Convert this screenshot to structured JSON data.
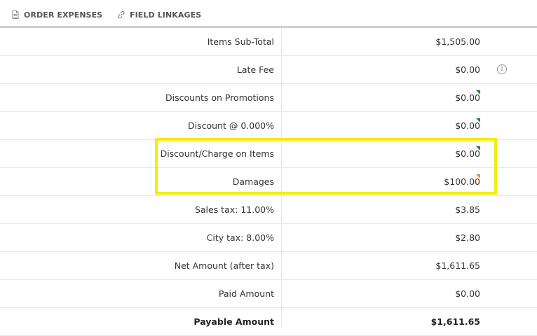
{
  "tabs": [
    {
      "label": "ORDER EXPENSES",
      "icon": "document-icon"
    },
    {
      "label": "FIELD LINKAGES",
      "icon": "link-icon"
    }
  ],
  "rows": [
    {
      "label": "Items Sub-Total",
      "value": "$1,505.00"
    },
    {
      "label": "Late Fee",
      "value": "$0.00",
      "icon": "info-icon"
    },
    {
      "label": "Discounts on Promotions",
      "value": "$0.00",
      "marker": "green"
    },
    {
      "label": "Discount @ 0.000%",
      "value": "$0.00",
      "marker": "green"
    },
    {
      "label": "Discount/Charge on Items",
      "value": "$0.00",
      "marker": "green"
    },
    {
      "label": "Damages",
      "value": "$100.00",
      "marker": "orange"
    },
    {
      "label": "Sales tax: 11.00%",
      "value": "$3.85"
    },
    {
      "label": "City tax: 8.00%",
      "value": "$2.80"
    },
    {
      "label": "Net Amount (after tax)",
      "value": "$1,611.65"
    },
    {
      "label": "Paid Amount",
      "value": "$0.00"
    },
    {
      "label": "Payable Amount",
      "value": "$1,611.65",
      "bold": true
    }
  ],
  "colors": {
    "highlight": "#f5ed00",
    "marker_green": "#1f8a1f",
    "marker_orange": "#e58a3a"
  }
}
